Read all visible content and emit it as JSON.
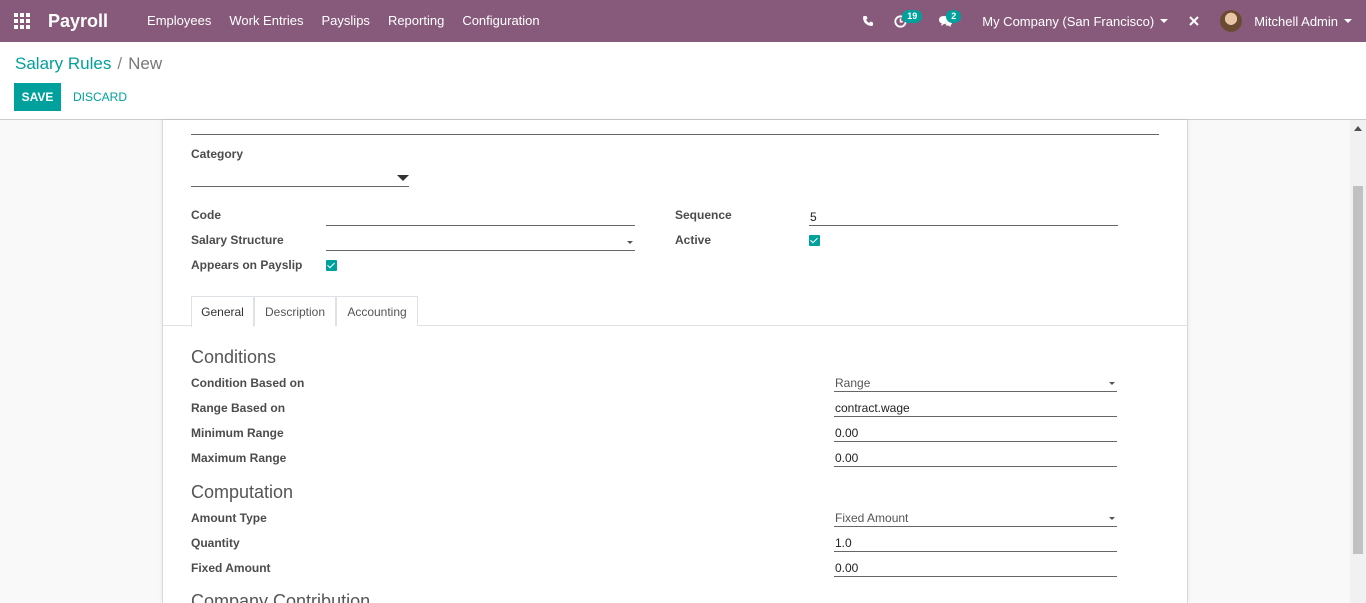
{
  "navbar": {
    "app_name": "Payroll",
    "menu": [
      "Employees",
      "Work Entries",
      "Payslips",
      "Reporting",
      "Configuration"
    ],
    "activity_count": "19",
    "message_count": "2",
    "company": "My Company (San Francisco)",
    "user": "Mitchell Admin",
    "bg_color": "#875a7b"
  },
  "breadcrumb": {
    "parent": "Salary Rules",
    "separator": "/",
    "current": "New"
  },
  "buttons": {
    "save": "SAVE",
    "discard": "DISCARD"
  },
  "form": {
    "name_value": "",
    "category": {
      "label": "Category",
      "value": ""
    },
    "code": {
      "label": "Code",
      "value": ""
    },
    "salary_structure": {
      "label": "Salary Structure",
      "value": ""
    },
    "appears_on_payslip": {
      "label": "Appears on Payslip",
      "checked": true
    },
    "sequence": {
      "label": "Sequence",
      "value": "5"
    },
    "active": {
      "label": "Active",
      "checked": true
    }
  },
  "tabs": [
    "General",
    "Description",
    "Accounting"
  ],
  "active_tab": "General",
  "conditions": {
    "title": "Conditions",
    "condition_based_on": {
      "label": "Condition Based on",
      "value": "Range"
    },
    "range_based_on": {
      "label": "Range Based on",
      "value": "contract.wage"
    },
    "minimum_range": {
      "label": "Minimum Range",
      "value": "0.00"
    },
    "maximum_range": {
      "label": "Maximum Range",
      "value": "0.00"
    }
  },
  "computation": {
    "title": "Computation",
    "amount_type": {
      "label": "Amount Type",
      "value": "Fixed Amount"
    },
    "quantity": {
      "label": "Quantity",
      "value": "1.0"
    },
    "fixed_amount": {
      "label": "Fixed Amount",
      "value": "0.00"
    }
  },
  "company_contribution": {
    "title": "Company Contribution"
  },
  "accent_color": "#00a09d"
}
